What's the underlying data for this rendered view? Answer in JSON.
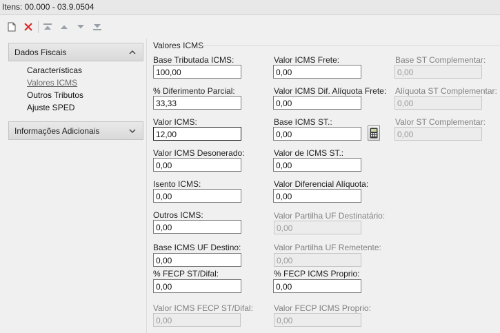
{
  "title": "Itens: 00.000 - 03.9.0504",
  "toolbar": {
    "icons": [
      "new-document-icon",
      "delete-icon",
      "move-first-icon",
      "move-up-icon",
      "move-down-icon",
      "move-last-icon"
    ],
    "colors": {
      "delete": "#e02020",
      "arrows": "#9aa0a8"
    }
  },
  "sidebar": {
    "groups": [
      {
        "label": "Dados Fiscais",
        "expanded": true
      },
      {
        "label": "Informações Adicionais",
        "expanded": false
      }
    ],
    "items": [
      {
        "label": "Características",
        "active": false
      },
      {
        "label": "Valores ICMS",
        "active": true
      },
      {
        "label": "Outros Tributos",
        "active": false
      },
      {
        "label": "Ajuste SPED",
        "active": false
      }
    ]
  },
  "section": {
    "title": "Valores ICMS"
  },
  "fields": {
    "base_tributada_icms": {
      "label": "Base Tributada ICMS:",
      "value": "100,00"
    },
    "diferimento_parcial": {
      "label": "% Diferimento Parcial:",
      "value": "33,33"
    },
    "valor_icms": {
      "label": "Valor ICMS:",
      "value": "12,00"
    },
    "valor_icms_desonerado": {
      "label": "Valor ICMS Desonerado:",
      "value": "0,00"
    },
    "isento_icms": {
      "label": "Isento ICMS:",
      "value": "0,00"
    },
    "outros_icms": {
      "label": "Outros ICMS:",
      "value": "0,00"
    },
    "base_icms_uf_destino": {
      "label": "Base ICMS UF Destino:",
      "value": "0,00"
    },
    "fecp_st_difal": {
      "label": "% FECP ST/Difal:",
      "value": "0,00"
    },
    "valor_icms_fecp_st_difal": {
      "label": "Valor ICMS FECP ST/Difal:",
      "value": "0,00"
    },
    "valor_icms_frete": {
      "label": "Valor ICMS Frete:",
      "value": "0,00"
    },
    "valor_icms_dif_aliquota_frete": {
      "label": "Valor ICMS Dif. Alíquota Frete:",
      "value": "0,00"
    },
    "base_icms_st": {
      "label": "Base ICMS ST.:",
      "value": "0,00"
    },
    "valor_de_icms_st": {
      "label": "Valor de ICMS ST.:",
      "value": "0,00"
    },
    "valor_diferencial_aliquota": {
      "label": "Valor Diferencial Alíquota:",
      "value": "0,00"
    },
    "valor_partilha_uf_destinatario": {
      "label": "Valor Partilha UF Destinatário:",
      "value": "0,00"
    },
    "valor_partilha_uf_remetente": {
      "label": "Valor Partilha UF Remetente:",
      "value": "0,00"
    },
    "fecp_icms_proprio": {
      "label": "% FECP ICMS Proprio:",
      "value": "0,00"
    },
    "valor_fecp_icms_proprio": {
      "label": "Valor FECP ICMS Proprio:",
      "value": "0,00"
    },
    "base_st_complementar": {
      "label": "Base ST Complementar:",
      "value": "0,00"
    },
    "aliquota_st_complementar": {
      "label": "Alíquota ST Complementar:",
      "value": "0,00"
    },
    "valor_st_complementar": {
      "label": "Valor ST Complementar:",
      "value": "0,00"
    }
  }
}
